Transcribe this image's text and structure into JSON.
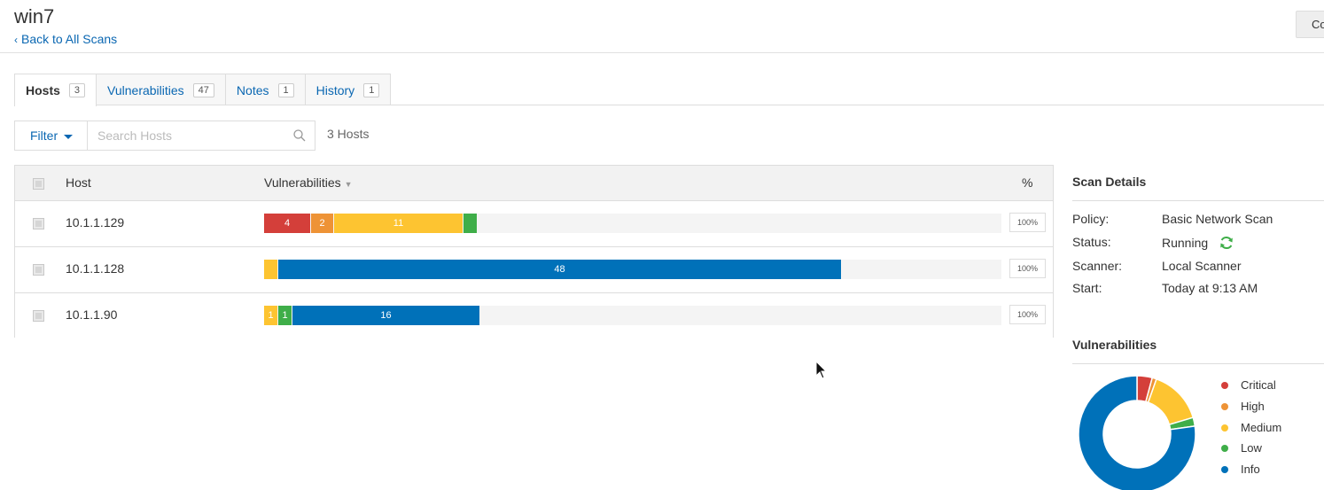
{
  "header": {
    "title": "win7",
    "back_link": "Back to All Scans",
    "top_button": "Co"
  },
  "tabs": [
    {
      "label": "Hosts",
      "count": "3",
      "active": true
    },
    {
      "label": "Vulnerabilities",
      "count": "47",
      "active": false
    },
    {
      "label": "Notes",
      "count": "1",
      "active": false
    },
    {
      "label": "History",
      "count": "1",
      "active": false
    }
  ],
  "toolbar": {
    "filter_label": "Filter",
    "search_placeholder": "Search Hosts",
    "search_value": "",
    "host_count": "3 Hosts"
  },
  "table": {
    "columns": {
      "host": "Host",
      "vulnerabilities": "Vulnerabilities",
      "percent": "%"
    },
    "rows": [
      {
        "host": "10.1.1.129",
        "percent": "100%",
        "segments": [
          {
            "severity": "critical",
            "count": 4,
            "label": "4"
          },
          {
            "severity": "high",
            "count": 2,
            "label": "2"
          },
          {
            "severity": "medium",
            "count": 11,
            "label": "11"
          },
          {
            "severity": "low",
            "count": 1,
            "label": ""
          }
        ]
      },
      {
        "host": "10.1.1.128",
        "percent": "100%",
        "segments": [
          {
            "severity": "medium",
            "count": 1,
            "label": ""
          },
          {
            "severity": "info",
            "count": 48,
            "label": "48"
          }
        ]
      },
      {
        "host": "10.1.1.90",
        "percent": "100%",
        "segments": [
          {
            "severity": "medium",
            "count": 1,
            "label": "1"
          },
          {
            "severity": "low",
            "count": 1,
            "label": "1"
          },
          {
            "severity": "info",
            "count": 16,
            "label": "16"
          }
        ]
      }
    ]
  },
  "scan_details": {
    "title": "Scan Details",
    "policy_label": "Policy:",
    "policy_value": "Basic Network Scan",
    "status_label": "Status:",
    "status_value": "Running",
    "scanner_label": "Scanner:",
    "scanner_value": "Local Scanner",
    "start_label": "Start:",
    "start_value": "Today at 9:13 AM"
  },
  "vulnerabilities_panel": {
    "title": "Vulnerabilities",
    "legend": [
      {
        "label": "Critical",
        "severity": "critical"
      },
      {
        "label": "High",
        "severity": "high"
      },
      {
        "label": "Medium",
        "severity": "medium"
      },
      {
        "label": "Low",
        "severity": "low"
      },
      {
        "label": "Info",
        "severity": "info"
      }
    ],
    "donut_shares": {
      "critical": 0.042,
      "high": 0.012,
      "medium": 0.15,
      "low": 0.024,
      "info": 0.772
    }
  },
  "colors": {
    "critical": "#d43f3a",
    "high": "#ee9336",
    "medium": "#fdc431",
    "low": "#3fae49",
    "info": "#0071b9",
    "link": "#0a67b2",
    "running": "#3fae49"
  },
  "icons": {
    "back": "chevron-left-icon",
    "search": "search-icon",
    "status": "refresh-icon",
    "filter_caret": "caret-down-icon"
  }
}
